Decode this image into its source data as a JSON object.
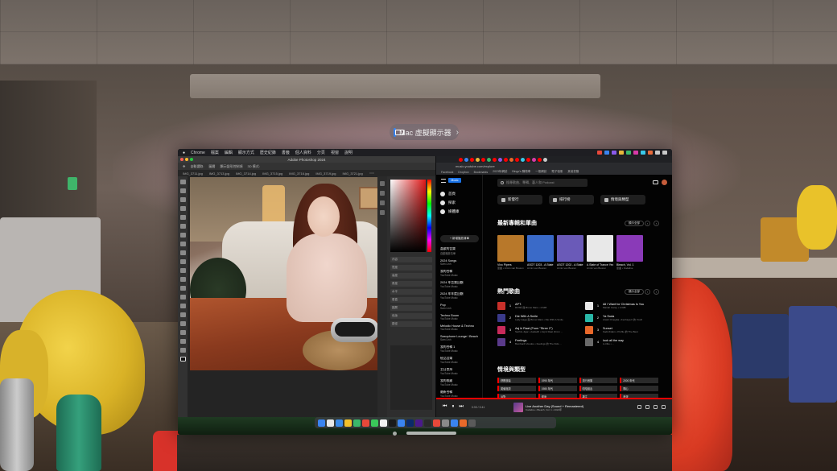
{
  "virtual_display": {
    "label": "Mac 虛擬顯示器",
    "chevron": "›"
  },
  "mac_menubar": {
    "items": [
      "Chrome",
      "檔案",
      "編輯",
      "顯示方式",
      "歷史紀錄",
      "書籤",
      "個人資料",
      "分頁",
      "視窗",
      "說明"
    ]
  },
  "photoshop": {
    "title": "Adobe Photoshop 2024",
    "options": [
      "自動選取:",
      "圖層",
      "顯示變形控制項",
      "3D 模式:"
    ],
    "tabs": [
      "IMG_3711.jpg",
      "IMG_3713.jpg",
      "IMG_3714.jpg",
      "IMG_3715.jpg",
      "IMG_3716.jpg",
      "IMG_3719.jpg",
      "IMG_3721.jpg",
      "IMG_3723.jpg @ 16% (RGB/8)"
    ],
    "panel_rows": [
      "內容",
      "寬度",
      "高度",
      "角度",
      "水平",
      "垂直",
      "圖層",
      "色版",
      "路徑"
    ]
  },
  "browser": {
    "url": "music.youtube.com/explore",
    "bookmarks": [
      "Facebook",
      "Dropbox",
      "Bookmarks",
      "2023年網誌",
      "Bingo's 購物車",
      "一般網誌",
      "電子相冊",
      "其他書籤"
    ]
  },
  "ytm": {
    "logo": "Music",
    "search_placeholder": "搜尋歌曲、專輯、藝人和 Podcast",
    "nav": [
      {
        "label": "首頁",
        "icon": "home-icon"
      },
      {
        "label": "探索",
        "icon": "explore-icon"
      },
      {
        "label": "媒體庫",
        "icon": "library-icon"
      }
    ],
    "new_playlist": "+ 新增播放清單",
    "playlists": [
      {
        "name": "喜歡的音樂",
        "sub": "自動播放清單"
      },
      {
        "name": "2024 Songs",
        "sub": "Sam Linh"
      },
      {
        "name": "我的合輯",
        "sub": "YouTube Music"
      },
      {
        "name": "2024 年音樂回顧",
        "sub": "YouTube Music"
      },
      {
        "name": "2024 年年度回顧",
        "sub": "YouTube Music"
      },
      {
        "name": "Pop",
        "sub": "Sam Linh"
      },
      {
        "name": "Techno Boom",
        "sub": "YouTube Music"
      },
      {
        "name": "Melodic House & Techno",
        "sub": "YouTube Music"
      },
      {
        "name": "Saxophone Lounge / Beach",
        "sub": "Sam Linh"
      },
      {
        "name": "我的合輯 1",
        "sub": "YouTube Music"
      },
      {
        "name": "極品音樂",
        "sub": "YouTube Music"
      },
      {
        "name": "主日崇拜",
        "sub": "YouTube Music"
      },
      {
        "name": "我的收藏",
        "sub": "YouTube Music"
      },
      {
        "name": "最新合輯",
        "sub": "YouTube Music"
      }
    ],
    "chips": [
      {
        "label": "新發行",
        "icon": "new-release-icon"
      },
      {
        "label": "排行榜",
        "icon": "chart-icon"
      },
      {
        "label": "情境與類型",
        "icon": "mood-icon"
      }
    ],
    "section_new": "最新專輯和單曲",
    "section_more": "顯示全部",
    "albums": [
      {
        "title": "Vivo Pipers",
        "sub": "單曲 • Armin van Buuren",
        "color": "#b8782a"
      },
      {
        "title": "ASOT 1203 - A State of Trance Episode",
        "sub": "Armin van Buuren",
        "color": "#3a6ac8"
      },
      {
        "title": "ASOT 1202 - A State of Trance Episode",
        "sub": "Armin van Buuren",
        "color": "#6a5ab8"
      },
      {
        "title": "A State of Trance Year Mix 2024",
        "sub": "Armin van Buuren",
        "color": "#e8e8e8"
      },
      {
        "title": "Bleach, Vol. 1",
        "sub": "單曲 • Kodaline",
        "color": "#8a3ab8"
      }
    ],
    "section_songs": "熱門歌曲",
    "songs": [
      {
        "rank": "1",
        "title": "APT.",
        "artist": "ROSÉ 與 Bruno Mars • 4.64B",
        "color": "#c8302a"
      },
      {
        "rank": "1",
        "title": "All I Want for Christmas Is You",
        "artist": "Mariah Carey • 2.03B",
        "color": "#e8e8e8"
      },
      {
        "rank": "2",
        "title": "Die With A Smile",
        "artist": "Lady Gaga 與 Bruno Mars • Die With A Smile",
        "color": "#3a3a8a"
      },
      {
        "rank": "2",
        "title": "Ya Suda",
        "artist": "Arash Omegba • Fenhaya II 的 Youth",
        "color": "#2ab8a8"
      },
      {
        "rank": "3",
        "title": "Asj ki Raat (From \"Stree 2\")",
        "artist": "Sachin-Jigar • Aasladh • Asj ki Raat (From ...",
        "color": "#c82a5a"
      },
      {
        "rank": "3",
        "title": "Sunset",
        "artist": "KadmKdam • Profile 的 The Best",
        "color": "#e8682a"
      },
      {
        "rank": "4",
        "title": "Feelings",
        "artist": "Bombardi Voodoo • Feelings 的 The Kids ...",
        "color": "#5a3a8a"
      },
      {
        "rank": "4",
        "title": "look all the way",
        "artist": "A-tribe • ...",
        "color": "#6a6a6a"
      }
    ],
    "section_moods": "情境與類型",
    "moods": [
      "紓壓放鬆",
      "1990 年代",
      "流行音樂",
      "2000 年代",
      "英倫搖滾",
      "1980 年代",
      "嘻哈饒舌",
      "開心",
      "派對",
      "健身",
      "專注",
      "浪漫"
    ],
    "player": {
      "title": "Live Another Day (Sound + Remastered)",
      "sub": "Kodaline • Bleach, Vol. 1 • 2024年",
      "time": "0:33 / 3:41"
    }
  },
  "colors": {
    "accent": "#ff0000",
    "ytm_bg": "#030303",
    "ps_bg": "#2b2b2b"
  }
}
